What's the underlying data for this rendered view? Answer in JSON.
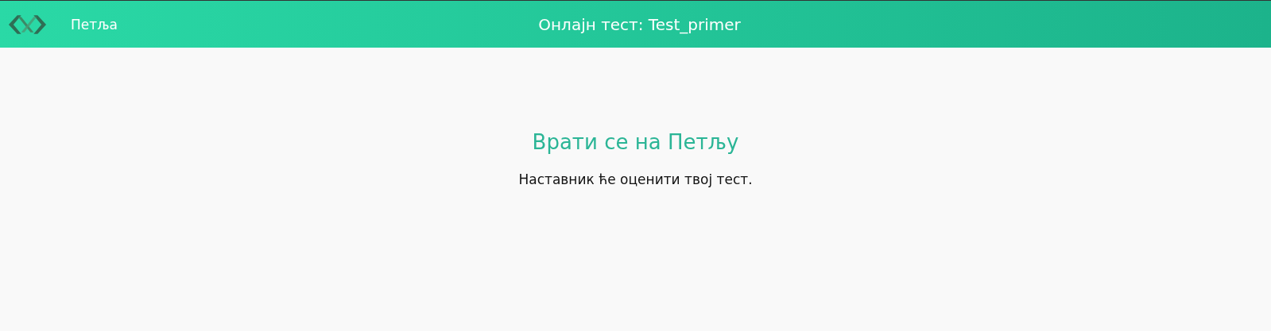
{
  "header": {
    "brand": "Петља",
    "title": "Онлајн тест: Test_primer"
  },
  "content": {
    "link": "Врати се на Петљу",
    "message": "Наставник ће оценити твој тест."
  }
}
